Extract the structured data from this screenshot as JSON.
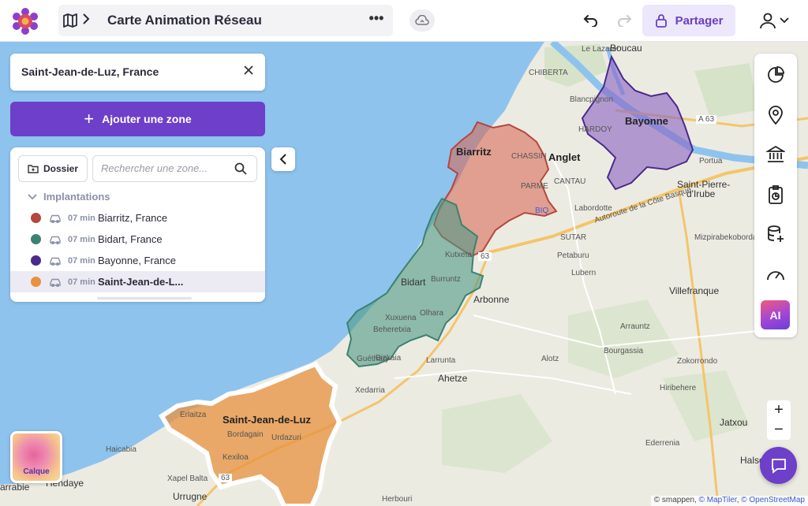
{
  "header": {
    "title": "Carte Animation Réseau",
    "more": "•••",
    "share_label": "Partager"
  },
  "search": {
    "value": "Saint-Jean-de-Luz, France"
  },
  "add_zone_label": "Ajouter une zone",
  "panel": {
    "dossier_label": "Dossier",
    "search_placeholder": "Rechercher une zone...",
    "group_label": "Implantations",
    "zones": [
      {
        "color": "#b5473b",
        "time": "07 min",
        "name": "Biarritz, France"
      },
      {
        "color": "#3c8270",
        "time": "07 min",
        "name": "Bidart, France"
      },
      {
        "color": "#4b2a8c",
        "time": "07 min",
        "name": "Bayonne, France"
      },
      {
        "color": "#e8913e",
        "time": "07 min",
        "name": "Saint-Jean-de-L..."
      }
    ]
  },
  "toolbar": {
    "ai_label": "AI"
  },
  "zoom": {
    "in": "+",
    "out": "−"
  },
  "calque_label": "Calque",
  "attribution": {
    "prefix": "© smappen, ",
    "maptiler": "© MapTiler",
    "sep": ", ",
    "osm": "© OpenStreetMap"
  },
  "map_labels": {
    "boucau": "Boucau",
    "le_lazaret": "Le Lazaret",
    "chiberta": "CHIBERTA",
    "blancpignon": "Blancpignon",
    "bayonne": "Bayonne",
    "hardoy": "HARDOY",
    "a63_top": "A 63",
    "biarritz": "Biarritz",
    "anglet": "Anglet",
    "chassin": "CHASSIN",
    "parme": "PARME",
    "cantau": "CANTAU",
    "saint_pierre": "Saint-Pierre-",
    "d_irube": "d'Irube",
    "biq": "BIQ",
    "labordotte": "Labordotte",
    "autoroute": "Autoroute de la Côte Basque",
    "sutar": "SUTAR",
    "portua": "Portua",
    "mizpira": "Mizpirabekoborda",
    "petaburu": "Petaburu",
    "lubern": "Lubern",
    "kutxeta": "Kutxeta",
    "bidart": "Bidart",
    "burruntz": "Burruntz",
    "arbonne": "Arbonne",
    "a63_mid": "63",
    "villefranque": "Villefranque",
    "xuxuena": "Xuxuena",
    "olhara": "Olhara",
    "beheretxia": "Beheretxia",
    "guethary": "Guéthary",
    "bizkaia": "Bizkaia",
    "larrunta": "Larrunta",
    "ahetze": "Ahetze",
    "alotz": "Alotz",
    "arrauntz": "Arrauntz",
    "bourgassia": "Bourgassia",
    "zokorrondo": "Zokorrondo",
    "hiribehere": "Hiribehere",
    "jatxou": "Jatxou",
    "xedarria": "Xedarria",
    "erlaitza": "Erlaitza",
    "sjdl": "Saint-Jean-de-Luz",
    "bordagain": "Bordagain",
    "urdazuri": "Urdazuri",
    "haicabia": "Haicabia",
    "kexiloa": "Kexiloa",
    "xapel_balta": "Xapel Balta",
    "hendaye": "Hendaye",
    "arrabie": "arrabie",
    "a63_bot": "63",
    "urrugne": "Urrugne",
    "herbouri": "Herbouri",
    "halsou": "Halsou",
    "ederrenia": "Ederrenia"
  }
}
